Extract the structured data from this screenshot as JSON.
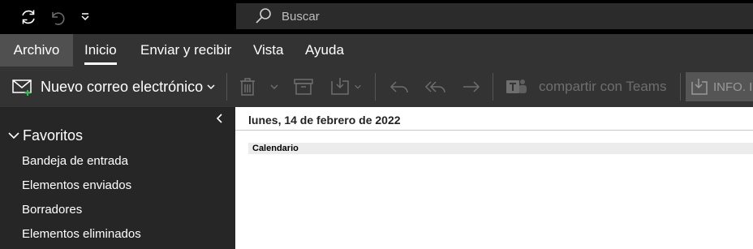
{
  "titlebar": {
    "icons": [
      "sync-icon",
      "undo-icon",
      "customize-qat-icon"
    ],
    "search": {
      "placeholder": "Buscar",
      "icon": "search-icon"
    }
  },
  "menu": {
    "items": [
      {
        "label": "Archivo"
      },
      {
        "label": "Inicio",
        "active": true
      },
      {
        "label": "Enviar y recibir"
      },
      {
        "label": "Vista"
      },
      {
        "label": "Ayuda"
      }
    ]
  },
  "ribbon": {
    "new_mail_label": "Nuevo correo electrónico",
    "teams_label": "compartir con Teams",
    "info_label": "INFO. IN"
  },
  "sidebar": {
    "favorites_label": "Favoritos",
    "folders": [
      {
        "label": "Bandeja de entrada"
      },
      {
        "label": "Elementos enviados"
      },
      {
        "label": "Borradores"
      },
      {
        "label": "Elementos eliminados"
      }
    ]
  },
  "content": {
    "date_header": "lunes, 14 de febrero de 2022",
    "calendar_label": "Calendario"
  },
  "colors": {
    "titlebar_bg": "#000000",
    "ribbon_bg": "#333333",
    "sidebar_bg": "#262626",
    "archivo_bg": "#505050",
    "content_bg": "#ffffff"
  }
}
